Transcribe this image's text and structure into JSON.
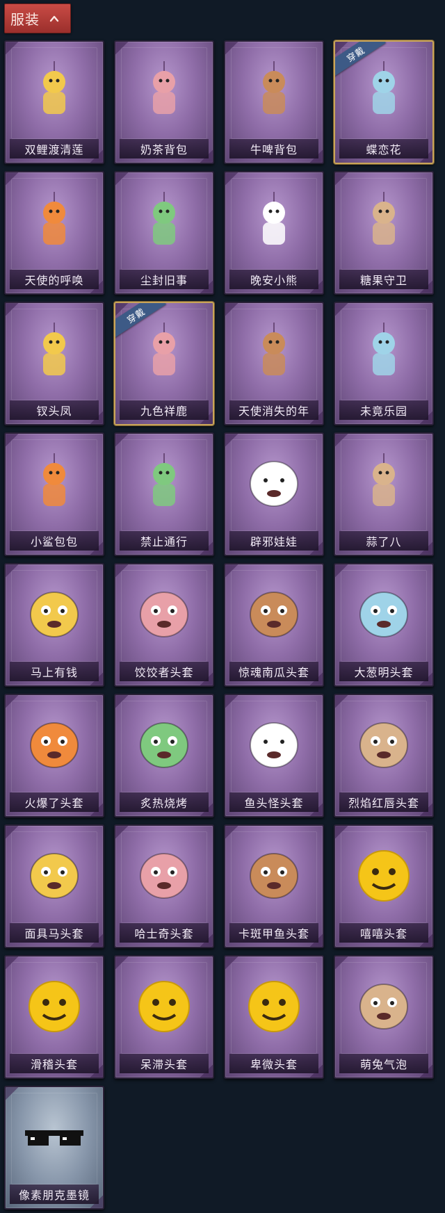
{
  "header": {
    "title": "服装",
    "toggle_icon": "chevron-up-icon"
  },
  "badge_text": "穿戴",
  "items": [
    {
      "name": "双鲤渡清莲",
      "icon": "koi-lotus-icon",
      "equipped": false
    },
    {
      "name": "奶茶背包",
      "icon": "milk-tea-backpack-icon",
      "equipped": false
    },
    {
      "name": "牛啤背包",
      "icon": "cow-beer-backpack-icon",
      "equipped": false
    },
    {
      "name": "蝶恋花",
      "icon": "butterfly-flower-icon",
      "equipped": true
    },
    {
      "name": "天使的呼唤",
      "icon": "angel-charm-icon",
      "equipped": false
    },
    {
      "name": "尘封旧事",
      "icon": "doll-charm-icon",
      "equipped": false
    },
    {
      "name": "晚安小熊",
      "icon": "bear-charm-icon",
      "equipped": false
    },
    {
      "name": "糖果守卫",
      "icon": "pumpkin-charm-icon",
      "equipped": false
    },
    {
      "name": "钗头凤",
      "icon": "phoenix-crown-doll-icon",
      "equipped": false
    },
    {
      "name": "九色祥鹿",
      "icon": "deer-charm-icon",
      "equipped": true
    },
    {
      "name": "天使消失的年",
      "icon": "veiled-doll-icon",
      "equipped": false
    },
    {
      "name": "未竟乐园",
      "icon": "bunny-girl-doll-icon",
      "equipped": false
    },
    {
      "name": "小鲨包包",
      "icon": "shark-bag-icon",
      "equipped": false
    },
    {
      "name": "禁止通行",
      "icon": "traffic-cone-icon",
      "equipped": false
    },
    {
      "name": "辟邪娃娃",
      "icon": "girl-head-icon",
      "equipped": false
    },
    {
      "name": "蒜了八",
      "icon": "garlic-icon",
      "equipped": false
    },
    {
      "name": "马上有钱",
      "icon": "red-horse-head-icon",
      "equipped": false
    },
    {
      "name": "饺饺者头套",
      "icon": "cloud-head-icon",
      "equipped": false
    },
    {
      "name": "惊魂南瓜头套",
      "icon": "pumpkin-head-icon",
      "equipped": false
    },
    {
      "name": "大葱明头套",
      "icon": "bok-choy-head-icon",
      "equipped": false
    },
    {
      "name": "火爆了头套",
      "icon": "fire-head-icon",
      "equipped": false
    },
    {
      "name": "炙热烧烤",
      "icon": "bbq-head-icon",
      "equipped": false
    },
    {
      "name": "鱼头怪头套",
      "icon": "fish-head-icon",
      "equipped": false
    },
    {
      "name": "烈焰红唇头套",
      "icon": "yellow-mask-head-icon",
      "equipped": false
    },
    {
      "name": "面具马头套",
      "icon": "horse-mask-icon",
      "equipped": false
    },
    {
      "name": "哈士奇头套",
      "icon": "husky-head-icon",
      "equipped": false
    },
    {
      "name": "卡斑甲鱼头套",
      "icon": "whale-head-icon",
      "equipped": false
    },
    {
      "name": "嘻嘻头套",
      "icon": "grin-emoji-head-icon",
      "equipped": false
    },
    {
      "name": "滑稽头套",
      "icon": "funny-emoji-head-icon",
      "equipped": false
    },
    {
      "name": "呆滞头套",
      "icon": "stare-emoji-head-icon",
      "equipped": false
    },
    {
      "name": "卑微头套",
      "icon": "humble-emoji-head-icon",
      "equipped": false
    },
    {
      "name": "萌兔气泡",
      "icon": "bubble-head-icon",
      "equipped": false
    },
    {
      "name": "像素朋克墨镜",
      "icon": "pixel-sunglasses-icon",
      "equipped": false,
      "special": true
    }
  ]
}
